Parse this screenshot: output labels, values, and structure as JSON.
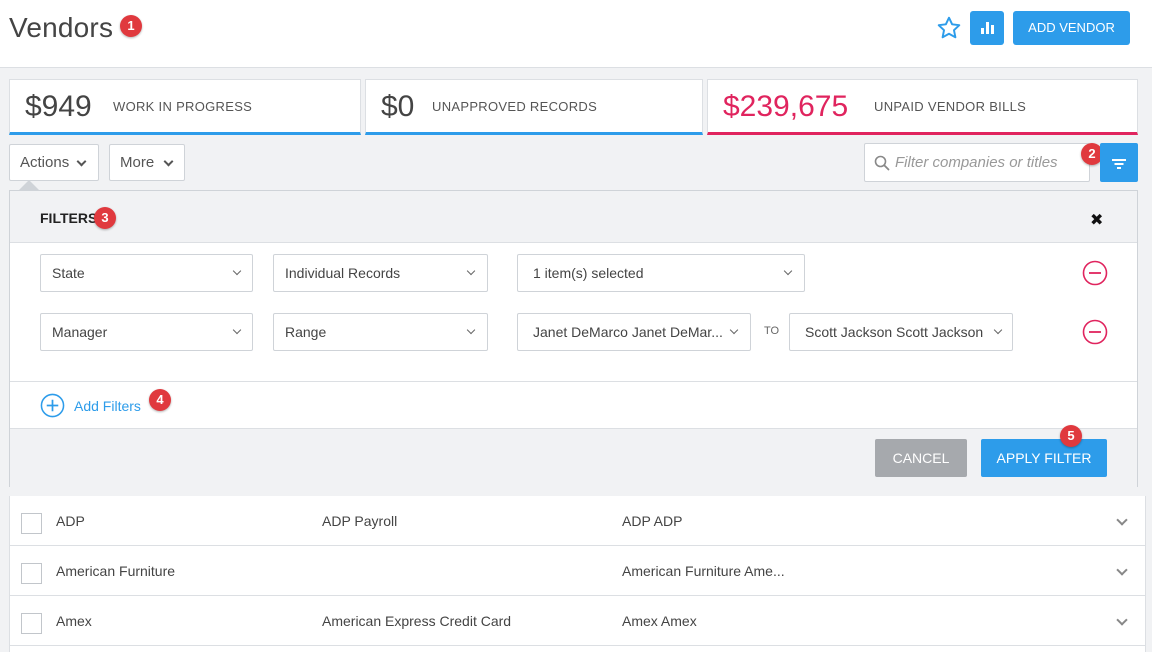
{
  "header": {
    "title": "Vendors",
    "add_vendor_label": "ADD VENDOR",
    "star_icon": "star-outline-icon",
    "chart_icon": "bar-chart-icon"
  },
  "badges": [
    "1",
    "2",
    "3",
    "4",
    "5"
  ],
  "stats": [
    {
      "value": "$949",
      "label": "WORK IN PROGRESS",
      "accent": "#2d9cea"
    },
    {
      "value": "$0",
      "label": "UNAPPROVED RECORDS",
      "accent": "#2d9cea"
    },
    {
      "value": "$239,675",
      "label": "UNPAID VENDOR BILLS",
      "accent": "#e0245e"
    }
  ],
  "toolbar": {
    "actions_label": "Actions",
    "more_label": "More",
    "search_placeholder": "Filter companies or titles"
  },
  "filters": {
    "title": "FILTERS",
    "rows": [
      {
        "field": "State",
        "mode": "Individual Records",
        "value": "1 item(s) selected"
      },
      {
        "field": "Manager",
        "mode": "Range",
        "from": "Janet DeMarco Janet DeMar...",
        "to_label": "TO",
        "to": "Scott Jackson Scott Jackson"
      }
    ],
    "add_label": "Add Filters",
    "cancel_label": "CANCEL",
    "apply_label": "APPLY FILTER"
  },
  "table": {
    "rows": [
      {
        "name": "ADP",
        "title": "ADP Payroll",
        "contact": "ADP ADP"
      },
      {
        "name": "American Furniture",
        "title": "",
        "contact": "American Furniture Ame..."
      },
      {
        "name": "Amex",
        "title": "American Express Credit Card",
        "contact": "Amex Amex"
      }
    ]
  },
  "colors": {
    "accent": "#2d9cea",
    "danger": "#e0245e",
    "badge": "#e0393e"
  }
}
